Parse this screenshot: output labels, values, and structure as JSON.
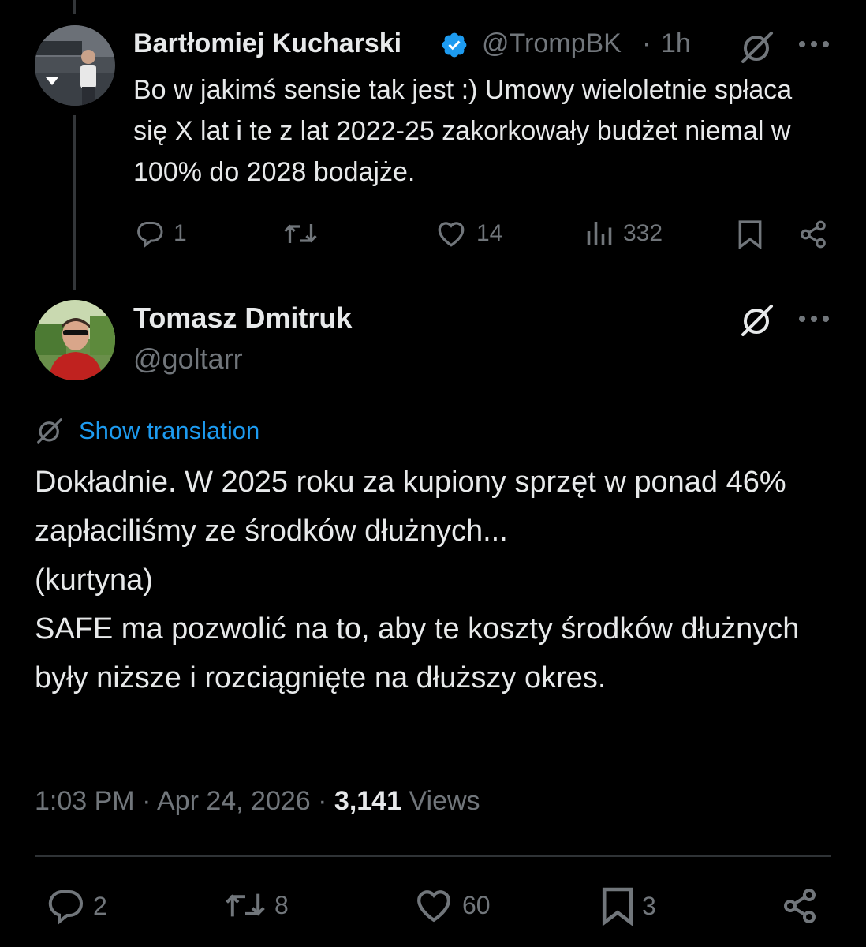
{
  "reply": {
    "author_name": "Bartłomiej Kucharski",
    "author_handle": "@TrompBK",
    "separator": "·",
    "time": "1h",
    "text": "Bo w jakimś sensie tak jest :) Umowy wieloletnie spłaca się X lat i te z lat 2022-25 zakorkowały budżet niemal w 100% do 2028 bodajże.",
    "replies": "1",
    "likes": "14",
    "views": "332"
  },
  "main": {
    "author_name": "Tomasz Dmitruk",
    "author_handle": "@goltarr",
    "translate_label": "Show translation",
    "text": "Dokładnie. W 2025 roku za kupiony sprzęt w ponad 46% zapłaciliśmy ze środków dłużnych...\n(kurtyna)\nSAFE ma pozwolić na to, aby te koszty środków dłużnych były niższe i rozciągnięte na dłuższy okres.",
    "time": "1:03 PM",
    "date": "Apr 24, 2026",
    "views_count": "3,141",
    "views_label": "Views",
    "dot": "·",
    "replies": "2",
    "reposts": "8",
    "likes": "60",
    "bookmarks": "3"
  },
  "colors": {
    "background": "#000000",
    "text": "#e7e9ea",
    "secondary": "#71767b",
    "accent": "#1d9bf0"
  }
}
